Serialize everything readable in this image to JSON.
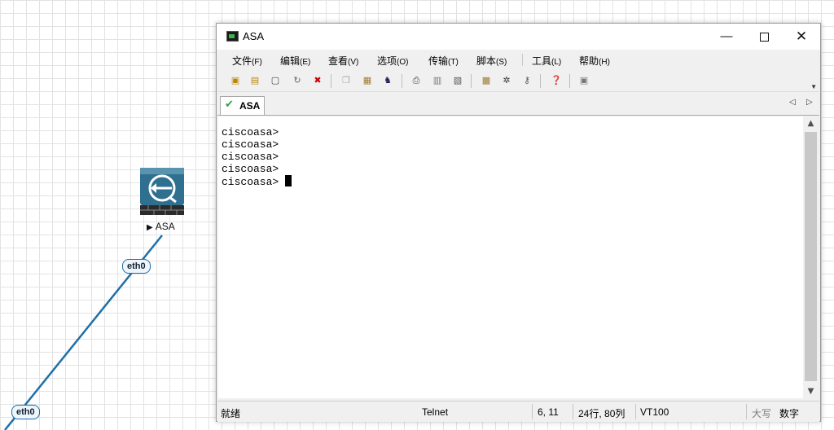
{
  "topology": {
    "device_label": "ASA",
    "interfaces": [
      "eth0",
      "eth0"
    ]
  },
  "window": {
    "title": "ASA",
    "controls": {
      "minimize": "—",
      "maximize": "",
      "close": "✕"
    }
  },
  "menu": [
    {
      "label": "文件",
      "key": "(F)"
    },
    {
      "label": "编辑",
      "key": "(E)"
    },
    {
      "label": "查看",
      "key": "(V)"
    },
    {
      "label": "选项",
      "key": "(O)"
    },
    {
      "label": "传输",
      "key": "(T)"
    },
    {
      "label": "脚本",
      "key": "(S)"
    },
    {
      "label": "工具",
      "key": "(L)"
    },
    {
      "label": "帮助",
      "key": "(H)"
    }
  ],
  "toolbar": {
    "icons": [
      "connect-icon",
      "quick-connect-icon",
      "connect-in-tab-icon",
      "reconnect-icon",
      "disconnect-icon",
      "copy-icon",
      "paste-icon",
      "find-icon",
      "print-icon",
      "print-setup-icon",
      "print-screen-icon",
      "session-options-icon",
      "global-options-icon",
      "key-icon",
      "help-icon",
      "sftp-icon"
    ]
  },
  "tabs": [
    {
      "label": "ASA",
      "status": "connected"
    }
  ],
  "terminal": {
    "lines": [
      "ciscoasa>",
      "ciscoasa>",
      "ciscoasa>",
      "ciscoasa>",
      "ciscoasa> "
    ]
  },
  "statusbar": {
    "ready": "就绪",
    "protocol": "Telnet",
    "cursor_pos": "6,  11",
    "size": "24行, 80列",
    "emulation": "VT100",
    "caps": "大写",
    "numlock": "数字"
  },
  "colors": {
    "link": "#1e6fa8",
    "tab_check": "#2ea043",
    "device_blue": "#2f6f8f"
  }
}
